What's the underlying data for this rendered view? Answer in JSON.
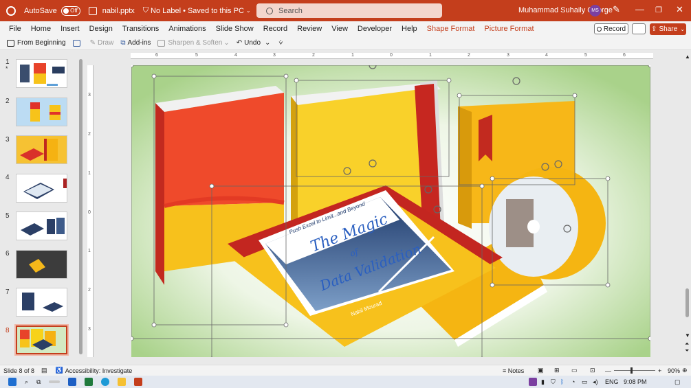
{
  "titlebar": {
    "autosave_label": "AutoSave",
    "autosave_state": "Off",
    "filename": "nabil.pptx",
    "sensitivity": "No Label",
    "save_status": "Saved to this PC",
    "search_placeholder": "Search",
    "user_name": "Muhammad Suhaily George",
    "user_initials": "MS",
    "accent_color": "#c43e1c"
  },
  "menu": {
    "items": [
      "File",
      "Home",
      "Insert",
      "Design",
      "Transitions",
      "Animations",
      "Slide Show",
      "Record",
      "Review",
      "View",
      "Developer",
      "Help"
    ],
    "context_tabs": [
      "Shape Format",
      "Picture Format"
    ],
    "record_label": "Record",
    "share_label": "Share"
  },
  "ribbon": {
    "from_beginning": "From Beginning",
    "draw": "Draw",
    "addins": "Add-ins",
    "sharpen": "Sharpen & Soften",
    "undo": "Undo"
  },
  "slides": {
    "numbers": [
      "1",
      "2",
      "3",
      "4",
      "5",
      "6",
      "7",
      "8"
    ],
    "active": "8"
  },
  "ruler": {
    "h_ticks": [
      "6",
      "5",
      "4",
      "3",
      "2",
      "1",
      "0",
      "1",
      "2",
      "3",
      "4",
      "5",
      "6"
    ],
    "v_ticks": [
      "3",
      "2",
      "1",
      "0",
      "1",
      "2",
      "3"
    ]
  },
  "slide_content": {
    "book_tagline": "Push Excel to Limit...and Beyond",
    "book_title_1": "The Magic",
    "book_title_2": "of",
    "book_title_3": "Data Validation",
    "book_author": "Nabil Mourad"
  },
  "status": {
    "slide_indicator": "Slide 8 of 8",
    "accessibility": "Accessibility: Investigate",
    "notes": "Notes",
    "zoom": "90%"
  },
  "taskbar": {
    "language": "ENG",
    "time": "9:08 PM"
  }
}
